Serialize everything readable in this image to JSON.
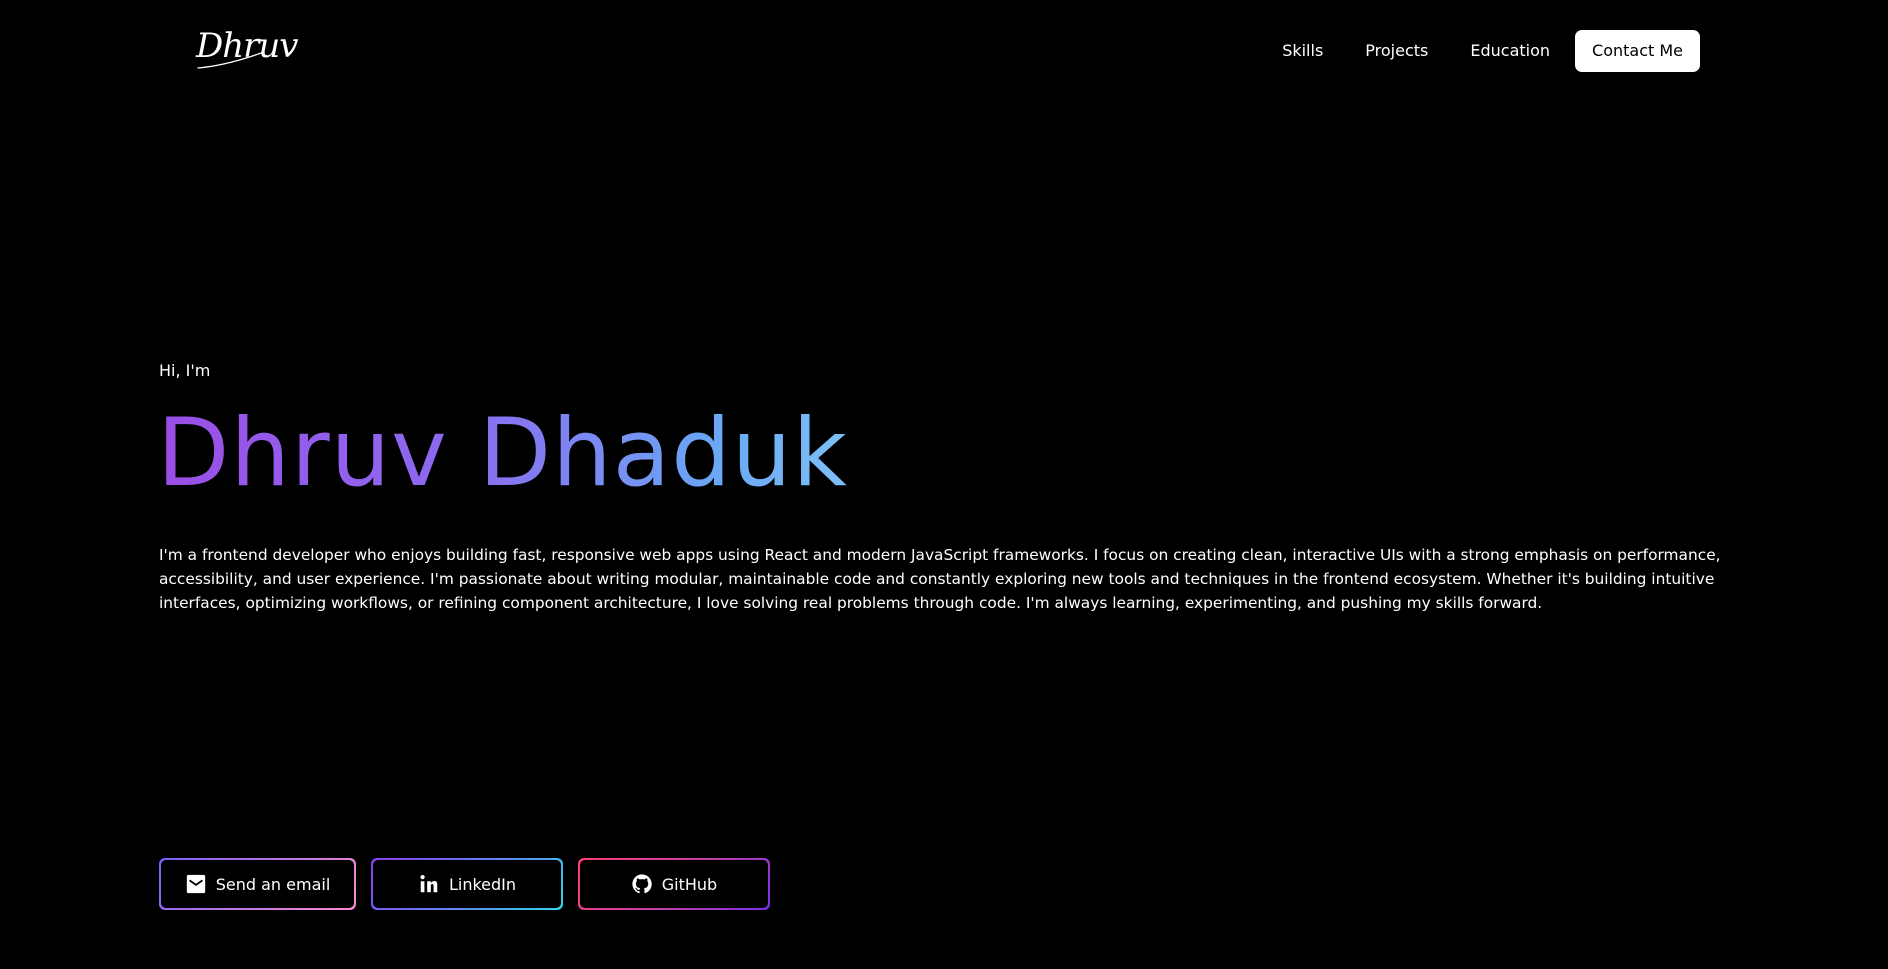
{
  "header": {
    "logo_text": "Dhruv",
    "nav": [
      {
        "label": "Skills"
      },
      {
        "label": "Projects"
      },
      {
        "label": "Education"
      }
    ],
    "contact_label": "Contact Me"
  },
  "hero": {
    "greeting": "Hi, I'm",
    "name": "Dhruv Dhaduk",
    "bio": "I'm a frontend developer who enjoys building fast, responsive web apps using React and modern JavaScript frameworks. I focus on creating clean, interactive UIs with a strong emphasis on performance, accessibility, and user experience. I'm passionate about writing modular, maintainable code and constantly exploring new tools and techniques in the frontend ecosystem. Whether it's building intuitive interfaces, optimizing workflows, or refining component architecture, I love solving real problems through code. I'm always learning, experimenting, and pushing my skills forward.",
    "gradient_colors": [
      "#9b4ee6",
      "#8b6cf0",
      "#6aa6f4",
      "#7cc0f6"
    ]
  },
  "actions": [
    {
      "label": "Send an email",
      "icon": "mail-icon"
    },
    {
      "label": "LinkedIn",
      "icon": "linkedin-icon"
    },
    {
      "label": "GitHub",
      "icon": "github-icon"
    }
  ],
  "colors": {
    "background": "#000000",
    "text": "#ffffff",
    "contact_button_bg": "#ffffff"
  }
}
